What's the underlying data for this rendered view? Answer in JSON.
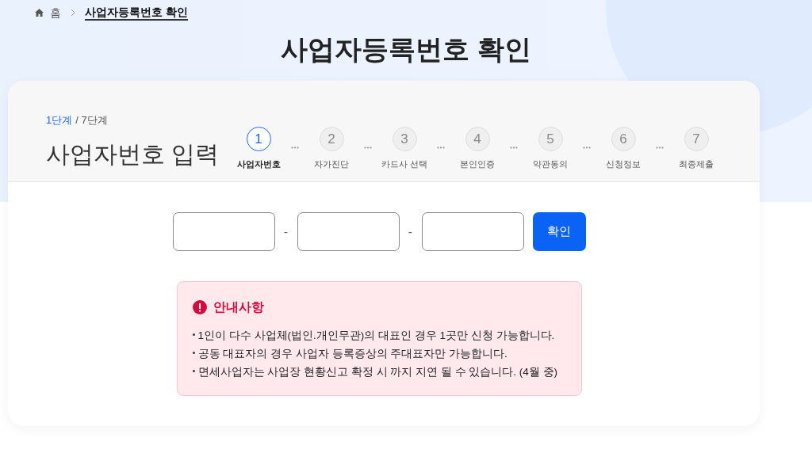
{
  "breadcrumb": {
    "home": "홈",
    "current": "사업자등록번호 확인"
  },
  "title": "사업자등록번호 확인",
  "step_indicator": {
    "current": "1단계",
    "total": "/ 7단계"
  },
  "step_title": "사업자번호 입력",
  "steps": [
    {
      "number": "1",
      "label": "사업자번호",
      "selected": true
    },
    {
      "number": "2",
      "label": "자가진단",
      "selected": false
    },
    {
      "number": "3",
      "label": "카드사 선택",
      "selected": false
    },
    {
      "number": "4",
      "label": "본인인증",
      "selected": false
    },
    {
      "number": "5",
      "label": "약관동의",
      "selected": false
    },
    {
      "number": "6",
      "label": "신청정보",
      "selected": false
    },
    {
      "number": "7",
      "label": "최종제출",
      "selected": false
    }
  ],
  "number_fields": [
    {
      "kind": "input"
    },
    {
      "kind": "input"
    },
    {
      "kind": "input"
    }
  ],
  "separator": "-",
  "confirm_button": "확인",
  "notice": {
    "title": "안내사항",
    "items": [
      "1인이 다수 사업체(법인.개인무관)의 대표인 경우 1곳만 신청 가능합니다.",
      "공동 대표자의 경우 사업자 등록증상의 주대표자만 가능합니다.",
      "면세사업자는 사업장 현황신고 확정 시 까지 지연 될 수 있습니다. (4월 중)"
    ]
  }
}
